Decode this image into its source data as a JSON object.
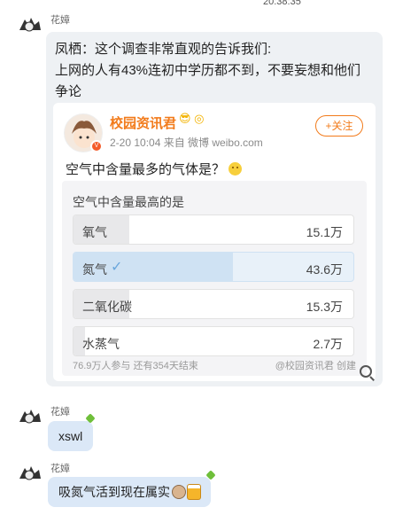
{
  "header": {
    "time": "20:38:35"
  },
  "messages": [
    {
      "sender": "花嫜",
      "text_line1": "凤栖：这个调查非常直观的告诉我们:",
      "text_line2": "上网的人有43%连初中学历都不到，不要妄想和他们",
      "text_line3": "争论"
    }
  ],
  "weibo_card": {
    "account_name": "校园资讯君",
    "meta": "2-20 10:04  来自 微博 weibo.com",
    "follow_label": "+关注",
    "question": "空气中含量最多的气体是？",
    "poll": {
      "title": "空气中含量最高的是",
      "options": [
        {
          "label": "氧气",
          "value": "15.1万",
          "selected": false
        },
        {
          "label": "氮气",
          "value": "43.6万",
          "selected": true
        },
        {
          "label": "二氧化碳",
          "value": "15.3万",
          "selected": false
        },
        {
          "label": "水蒸气",
          "value": "2.7万",
          "selected": false
        }
      ],
      "footer_left": "76.9万人参与  还有354天结束",
      "footer_right": "@校园资讯君 创建"
    }
  },
  "replies": [
    {
      "sender": "花嫜",
      "text": "xswl"
    },
    {
      "sender": "花嫜",
      "text": "吸氮气活到现在属实"
    }
  ],
  "colors": {
    "brand_orange": "#f27b1b",
    "bubble_gray": "#eef1f4",
    "bubble_blue": "#dbe8f7"
  }
}
